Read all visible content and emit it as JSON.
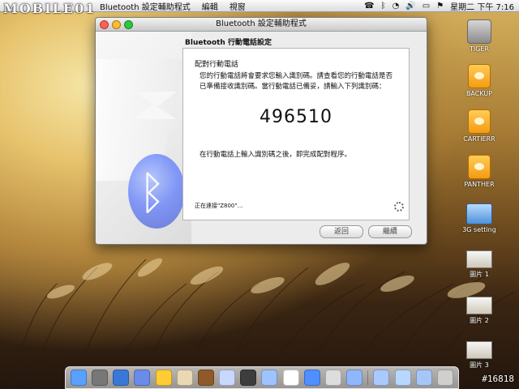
{
  "menubar": {
    "watermark_logo": "MOBILE01",
    "apple_label": "",
    "menu": [
      "Bluetooth 設定輔助程式",
      "編輯",
      "視窗"
    ],
    "datetime": "星期二 下午 7:16"
  },
  "desktop": {
    "icons": [
      {
        "name": "TIGER"
      },
      {
        "name": "BACKUP"
      },
      {
        "name": "CARTIERR"
      },
      {
        "name": "PANTHER"
      },
      {
        "name": "3G setting"
      },
      {
        "name": "圖片 1"
      },
      {
        "name": "圖片 2"
      },
      {
        "name": "圖片 3"
      }
    ]
  },
  "window": {
    "title": "Bluetooth 設定輔助程式",
    "section_title": "Bluetooth 行動電話設定",
    "panel": {
      "heading": "配對行動電話",
      "description": "您的行動電話將會要求您輸入識別碼。請查看您的行動電話是否已準備接收識別碼。當行動電話已備妥，請輸入下列識別碼：",
      "pin_code": "496510",
      "after_text": "在行動電話上輸入識別碼之後，即完成配對程序。",
      "status_text": "正在連接\"Z800\"…"
    },
    "buttons": {
      "back": "返回",
      "continue": "繼續"
    }
  },
  "watermark_tag": "#16818"
}
